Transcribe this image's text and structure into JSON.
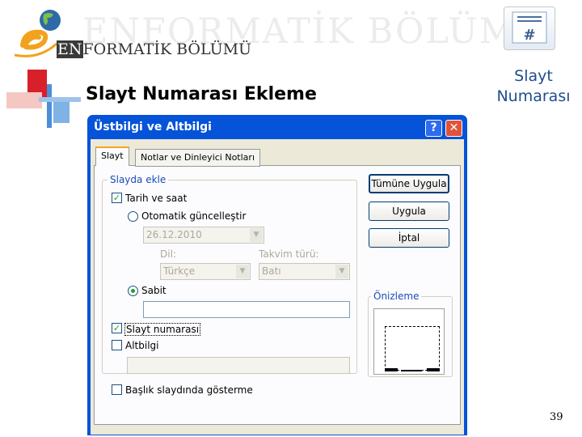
{
  "branding": {
    "watermark": "ENFORMATİK BÖLÜMÜ",
    "brand_prefix": "EN",
    "brand_rest": "FORMATİK BÖLÜMÜ"
  },
  "slide": {
    "title": "Slayt Numarası Ekleme",
    "page_number": "39"
  },
  "ribbon_button": {
    "icon": "hash-slide-icon",
    "label_line1": "Slayt",
    "label_line2": "Numarası"
  },
  "dialog": {
    "title": "Üstbilgi ve Altbilgi",
    "help_symbol": "?",
    "close_symbol": "✕",
    "tabs": [
      "Slayt",
      "Notlar ve Dinleyici Notları"
    ],
    "group_slayda_ekle": "Slayda ekle",
    "date_time": {
      "label": "Tarih ve saat",
      "checked": true
    },
    "auto_update": {
      "label": "Otomatik güncelleştir",
      "selected": false
    },
    "date_value": "26.12.2010",
    "language_label": "Dil:",
    "language_value": "Türkçe",
    "calendar_label": "Takvim türü:",
    "calendar_value": "Batı",
    "fixed": {
      "label": "Sabit",
      "selected": true,
      "value": ""
    },
    "slide_number": {
      "label": "Slayt numarası",
      "checked": true
    },
    "footer": {
      "label": "Altbilgi",
      "checked": false,
      "value": ""
    },
    "hide_on_title": {
      "label": "Başlık slaydında gösterme",
      "checked": false
    },
    "buttons": {
      "apply_all": "Tümüne Uygula",
      "apply": "Uygula",
      "cancel": "İptal"
    },
    "preview_label": "Önizleme",
    "check_mark": "✓",
    "dropdown_arrow": "▼",
    "colors": {
      "titlebar": "#0553d8",
      "dialog_face": "#ece9d8",
      "check": "#21a121",
      "close": "#e0533a"
    }
  }
}
